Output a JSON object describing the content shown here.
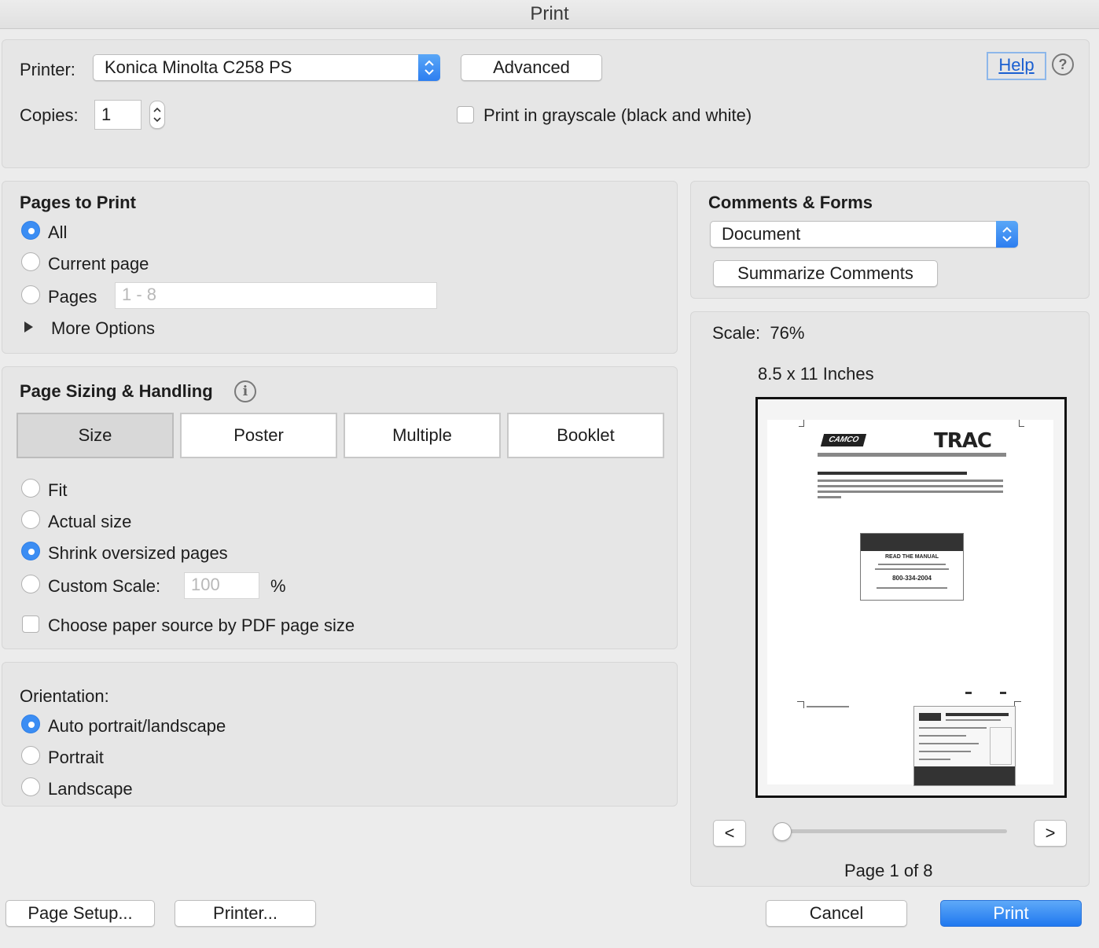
{
  "window": {
    "title": "Print"
  },
  "printer": {
    "label": "Printer:",
    "selected": "Konica Minolta C258 PS",
    "advanced_label": "Advanced",
    "help_label": "Help",
    "copies_label": "Copies:",
    "copies_value": "1",
    "grayscale_label": "Print in grayscale (black and white)",
    "grayscale_checked": false
  },
  "pages_to_print": {
    "title": "Pages to Print",
    "options": [
      {
        "label": "All",
        "selected": true
      },
      {
        "label": "Current page",
        "selected": false
      },
      {
        "label": "Pages",
        "selected": false
      }
    ],
    "range_placeholder": "1 - 8",
    "more_options_label": "More Options"
  },
  "page_sizing": {
    "title": "Page Sizing & Handling",
    "tabs": [
      {
        "label": "Size",
        "selected": true
      },
      {
        "label": "Poster",
        "selected": false
      },
      {
        "label": "Multiple",
        "selected": false
      },
      {
        "label": "Booklet",
        "selected": false
      }
    ],
    "options": [
      {
        "label": "Fit",
        "selected": false
      },
      {
        "label": "Actual size",
        "selected": false
      },
      {
        "label": "Shrink oversized pages",
        "selected": true
      },
      {
        "label": "Custom Scale:",
        "selected": false
      }
    ],
    "custom_scale_placeholder": "100",
    "percent_symbol": "%",
    "paper_source_label": "Choose paper source by PDF page size",
    "paper_source_checked": false
  },
  "orientation": {
    "title": "Orientation:",
    "options": [
      {
        "label": "Auto portrait/landscape",
        "selected": true
      },
      {
        "label": "Portrait",
        "selected": false
      },
      {
        "label": "Landscape",
        "selected": false
      }
    ]
  },
  "comments_forms": {
    "title": "Comments & Forms",
    "selected": "Document",
    "summarize_label": "Summarize Comments"
  },
  "preview": {
    "scale_label": "Scale:  76%",
    "paper_size": "8.5 x 11 Inches",
    "prev_label": "<",
    "next_label": ">",
    "page_indicator": "Page 1 of 8",
    "slider_fraction": 0,
    "doc_brand_left": "CAMCO",
    "doc_brand_right": "TRAC",
    "doc_box_heading": "READ THE MANUAL",
    "doc_box_phone": "800-334-2004"
  },
  "footer": {
    "page_setup_label": "Page Setup...",
    "printer_label": "Printer...",
    "cancel_label": "Cancel",
    "print_label": "Print"
  },
  "colors": {
    "accent": "#3b8df3",
    "link": "#1a5fd1"
  }
}
